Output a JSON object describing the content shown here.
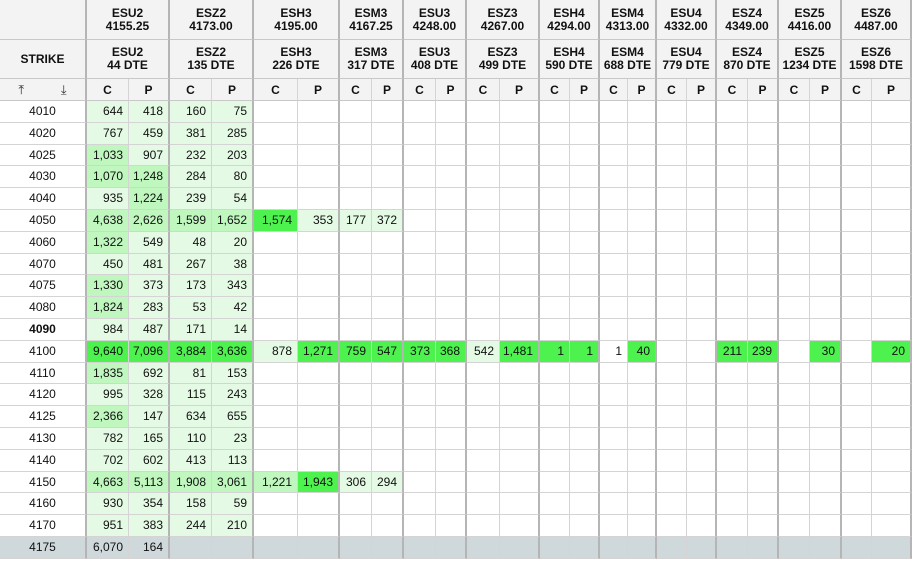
{
  "corner_label": "STRIKE",
  "icons": {
    "sort_top": "arrow-to-top-icon",
    "sort_down": "arrow-down-to-line-icon"
  },
  "call_label": "C",
  "put_label": "P",
  "colors": {
    "shade_low": "#e4fae4",
    "shade_mid": "#bff7bf",
    "shade_high": "#4ef24e",
    "last_row": "#cfd9dc"
  },
  "expiries": [
    {
      "symbol": "ESU2",
      "price": "4155.25",
      "dte": "44 DTE"
    },
    {
      "symbol": "ESZ2",
      "price": "4173.00",
      "dte": "135 DTE"
    },
    {
      "symbol": "ESH3",
      "price": "4195.00",
      "dte": "226 DTE"
    },
    {
      "symbol": "ESM3",
      "price": "4167.25",
      "dte": "317 DTE"
    },
    {
      "symbol": "ESU3",
      "price": "4248.00",
      "dte": "408 DTE"
    },
    {
      "symbol": "ESZ3",
      "price": "4267.00",
      "dte": "499 DTE"
    },
    {
      "symbol": "ESH4",
      "price": "4294.00",
      "dte": "590 DTE"
    },
    {
      "symbol": "ESM4",
      "price": "4313.00",
      "dte": "688 DTE"
    },
    {
      "symbol": "ESU4",
      "price": "4332.00",
      "dte": "779 DTE"
    },
    {
      "symbol": "ESZ4",
      "price": "4349.00",
      "dte": "870 DTE"
    },
    {
      "symbol": "ESZ5",
      "price": "4416.00",
      "dte": "1234 DTE"
    },
    {
      "symbol": "ESZ6",
      "price": "4487.00",
      "dte": "1598 DTE"
    }
  ],
  "rows": [
    {
      "strike": "4010",
      "cells": [
        [
          "644",
          "418"
        ],
        [
          "160",
          "75"
        ],
        [
          "",
          ""
        ],
        [
          "",
          ""
        ],
        [
          "",
          ""
        ],
        [
          "",
          ""
        ],
        [
          "",
          ""
        ],
        [
          "",
          ""
        ],
        [
          "",
          ""
        ],
        [
          "",
          ""
        ],
        [
          "",
          ""
        ],
        [
          "",
          ""
        ]
      ]
    },
    {
      "strike": "4020",
      "cells": [
        [
          "767",
          "459"
        ],
        [
          "381",
          "285"
        ],
        [
          "",
          ""
        ],
        [
          "",
          ""
        ],
        [
          "",
          ""
        ],
        [
          "",
          ""
        ],
        [
          "",
          ""
        ],
        [
          "",
          ""
        ],
        [
          "",
          ""
        ],
        [
          "",
          ""
        ],
        [
          "",
          ""
        ],
        [
          "",
          ""
        ]
      ]
    },
    {
      "strike": "4025",
      "cells": [
        [
          "1,033",
          "907"
        ],
        [
          "232",
          "203"
        ],
        [
          "",
          ""
        ],
        [
          "",
          ""
        ],
        [
          "",
          ""
        ],
        [
          "",
          ""
        ],
        [
          "",
          ""
        ],
        [
          "",
          ""
        ],
        [
          "",
          ""
        ],
        [
          "",
          ""
        ],
        [
          "",
          ""
        ],
        [
          "",
          ""
        ]
      ]
    },
    {
      "strike": "4030",
      "cells": [
        [
          "1,070",
          "1,248"
        ],
        [
          "284",
          "80"
        ],
        [
          "",
          ""
        ],
        [
          "",
          ""
        ],
        [
          "",
          ""
        ],
        [
          "",
          ""
        ],
        [
          "",
          ""
        ],
        [
          "",
          ""
        ],
        [
          "",
          ""
        ],
        [
          "",
          ""
        ],
        [
          "",
          ""
        ],
        [
          "",
          ""
        ]
      ]
    },
    {
      "strike": "4040",
      "cells": [
        [
          "935",
          "1,224"
        ],
        [
          "239",
          "54"
        ],
        [
          "",
          ""
        ],
        [
          "",
          ""
        ],
        [
          "",
          ""
        ],
        [
          "",
          ""
        ],
        [
          "",
          ""
        ],
        [
          "",
          ""
        ],
        [
          "",
          ""
        ],
        [
          "",
          ""
        ],
        [
          "",
          ""
        ],
        [
          "",
          ""
        ]
      ]
    },
    {
      "strike": "4050",
      "cells": [
        [
          "4,638",
          "2,626"
        ],
        [
          "1,599",
          "1,652"
        ],
        [
          "1,574",
          "353"
        ],
        [
          "177",
          "372"
        ],
        [
          "",
          ""
        ],
        [
          "",
          ""
        ],
        [
          "",
          ""
        ],
        [
          "",
          ""
        ],
        [
          "",
          ""
        ],
        [
          "",
          ""
        ],
        [
          "",
          ""
        ],
        [
          "",
          ""
        ]
      ]
    },
    {
      "strike": "4060",
      "cells": [
        [
          "1,322",
          "549"
        ],
        [
          "48",
          "20"
        ],
        [
          "",
          ""
        ],
        [
          "",
          ""
        ],
        [
          "",
          ""
        ],
        [
          "",
          ""
        ],
        [
          "",
          ""
        ],
        [
          "",
          ""
        ],
        [
          "",
          ""
        ],
        [
          "",
          ""
        ],
        [
          "",
          ""
        ],
        [
          "",
          ""
        ]
      ]
    },
    {
      "strike": "4070",
      "cells": [
        [
          "450",
          "481"
        ],
        [
          "267",
          "38"
        ],
        [
          "",
          ""
        ],
        [
          "",
          ""
        ],
        [
          "",
          ""
        ],
        [
          "",
          ""
        ],
        [
          "",
          ""
        ],
        [
          "",
          ""
        ],
        [
          "",
          ""
        ],
        [
          "",
          ""
        ],
        [
          "",
          ""
        ],
        [
          "",
          ""
        ]
      ]
    },
    {
      "strike": "4075",
      "cells": [
        [
          "1,330",
          "373"
        ],
        [
          "173",
          "343"
        ],
        [
          "",
          ""
        ],
        [
          "",
          ""
        ],
        [
          "",
          ""
        ],
        [
          "",
          ""
        ],
        [
          "",
          ""
        ],
        [
          "",
          ""
        ],
        [
          "",
          ""
        ],
        [
          "",
          ""
        ],
        [
          "",
          ""
        ],
        [
          "",
          ""
        ]
      ]
    },
    {
      "strike": "4080",
      "cells": [
        [
          "1,824",
          "283"
        ],
        [
          "53",
          "42"
        ],
        [
          "",
          ""
        ],
        [
          "",
          ""
        ],
        [
          "",
          ""
        ],
        [
          "",
          ""
        ],
        [
          "",
          ""
        ],
        [
          "",
          ""
        ],
        [
          "",
          ""
        ],
        [
          "",
          ""
        ],
        [
          "",
          ""
        ],
        [
          "",
          ""
        ]
      ]
    },
    {
      "strike": "4090",
      "bold": true,
      "cells": [
        [
          "984",
          "487"
        ],
        [
          "171",
          "14"
        ],
        [
          "",
          ""
        ],
        [
          "",
          ""
        ],
        [
          "",
          ""
        ],
        [
          "",
          ""
        ],
        [
          "",
          ""
        ],
        [
          "",
          ""
        ],
        [
          "",
          ""
        ],
        [
          "",
          ""
        ],
        [
          "",
          ""
        ],
        [
          "",
          ""
        ]
      ]
    },
    {
      "strike": "4100",
      "cells": [
        [
          "9,640",
          "7,096"
        ],
        [
          "3,884",
          "3,636"
        ],
        [
          "878",
          "1,271"
        ],
        [
          "759",
          "547"
        ],
        [
          "373",
          "368"
        ],
        [
          "542",
          "1,481"
        ],
        [
          "1",
          "1"
        ],
        [
          "1",
          "40"
        ],
        [
          "",
          ""
        ],
        [
          "211",
          "239"
        ],
        [
          "",
          "30"
        ],
        [
          "",
          "20"
        ]
      ]
    },
    {
      "strike": "4110",
      "cells": [
        [
          "1,835",
          "692"
        ],
        [
          "81",
          "153"
        ],
        [
          "",
          ""
        ],
        [
          "",
          ""
        ],
        [
          "",
          ""
        ],
        [
          "",
          ""
        ],
        [
          "",
          ""
        ],
        [
          "",
          ""
        ],
        [
          "",
          ""
        ],
        [
          "",
          ""
        ],
        [
          "",
          ""
        ],
        [
          "",
          ""
        ]
      ]
    },
    {
      "strike": "4120",
      "cells": [
        [
          "995",
          "328"
        ],
        [
          "115",
          "243"
        ],
        [
          "",
          ""
        ],
        [
          "",
          ""
        ],
        [
          "",
          ""
        ],
        [
          "",
          ""
        ],
        [
          "",
          ""
        ],
        [
          "",
          ""
        ],
        [
          "",
          ""
        ],
        [
          "",
          ""
        ],
        [
          "",
          ""
        ],
        [
          "",
          ""
        ]
      ]
    },
    {
      "strike": "4125",
      "cells": [
        [
          "2,366",
          "147"
        ],
        [
          "634",
          "655"
        ],
        [
          "",
          ""
        ],
        [
          "",
          ""
        ],
        [
          "",
          ""
        ],
        [
          "",
          ""
        ],
        [
          "",
          ""
        ],
        [
          "",
          ""
        ],
        [
          "",
          ""
        ],
        [
          "",
          ""
        ],
        [
          "",
          ""
        ],
        [
          "",
          ""
        ]
      ]
    },
    {
      "strike": "4130",
      "cells": [
        [
          "782",
          "165"
        ],
        [
          "110",
          "23"
        ],
        [
          "",
          ""
        ],
        [
          "",
          ""
        ],
        [
          "",
          ""
        ],
        [
          "",
          ""
        ],
        [
          "",
          ""
        ],
        [
          "",
          ""
        ],
        [
          "",
          ""
        ],
        [
          "",
          ""
        ],
        [
          "",
          ""
        ],
        [
          "",
          ""
        ]
      ]
    },
    {
      "strike": "4140",
      "cells": [
        [
          "702",
          "602"
        ],
        [
          "413",
          "113"
        ],
        [
          "",
          ""
        ],
        [
          "",
          ""
        ],
        [
          "",
          ""
        ],
        [
          "",
          ""
        ],
        [
          "",
          ""
        ],
        [
          "",
          ""
        ],
        [
          "",
          ""
        ],
        [
          "",
          ""
        ],
        [
          "",
          ""
        ],
        [
          "",
          ""
        ]
      ]
    },
    {
      "strike": "4150",
      "cells": [
        [
          "4,663",
          "5,113"
        ],
        [
          "1,908",
          "3,061"
        ],
        [
          "1,221",
          "1,943"
        ],
        [
          "306",
          "294"
        ],
        [
          "",
          ""
        ],
        [
          "",
          ""
        ],
        [
          "",
          ""
        ],
        [
          "",
          ""
        ],
        [
          "",
          ""
        ],
        [
          "",
          ""
        ],
        [
          "",
          ""
        ],
        [
          "",
          ""
        ]
      ]
    },
    {
      "strike": "4160",
      "cells": [
        [
          "930",
          "354"
        ],
        [
          "158",
          "59"
        ],
        [
          "",
          ""
        ],
        [
          "",
          ""
        ],
        [
          "",
          ""
        ],
        [
          "",
          ""
        ],
        [
          "",
          ""
        ],
        [
          "",
          ""
        ],
        [
          "",
          ""
        ],
        [
          "",
          ""
        ],
        [
          "",
          ""
        ],
        [
          "",
          ""
        ]
      ]
    },
    {
      "strike": "4170",
      "cells": [
        [
          "951",
          "383"
        ],
        [
          "244",
          "210"
        ],
        [
          "",
          ""
        ],
        [
          "",
          ""
        ],
        [
          "",
          ""
        ],
        [
          "",
          ""
        ],
        [
          "",
          ""
        ],
        [
          "",
          ""
        ],
        [
          "",
          ""
        ],
        [
          "",
          ""
        ],
        [
          "",
          ""
        ],
        [
          "",
          ""
        ]
      ]
    },
    {
      "strike": "4175",
      "cells": [
        [
          "6,070",
          "164"
        ],
        [
          "",
          ""
        ],
        [
          "",
          ""
        ],
        [
          "",
          ""
        ],
        [
          "",
          ""
        ],
        [
          "",
          ""
        ],
        [
          "",
          ""
        ],
        [
          "",
          ""
        ],
        [
          "",
          ""
        ],
        [
          "",
          ""
        ],
        [
          "",
          ""
        ],
        [
          "",
          ""
        ]
      ]
    }
  ],
  "shades": [
    [
      "lllll",
      "ll"
    ],
    [
      "lllll",
      "ll"
    ],
    [
      "lllll",
      "ll"
    ],
    [
      "lllll",
      "ll"
    ],
    [
      "lllll",
      "ll"
    ]
  ]
}
